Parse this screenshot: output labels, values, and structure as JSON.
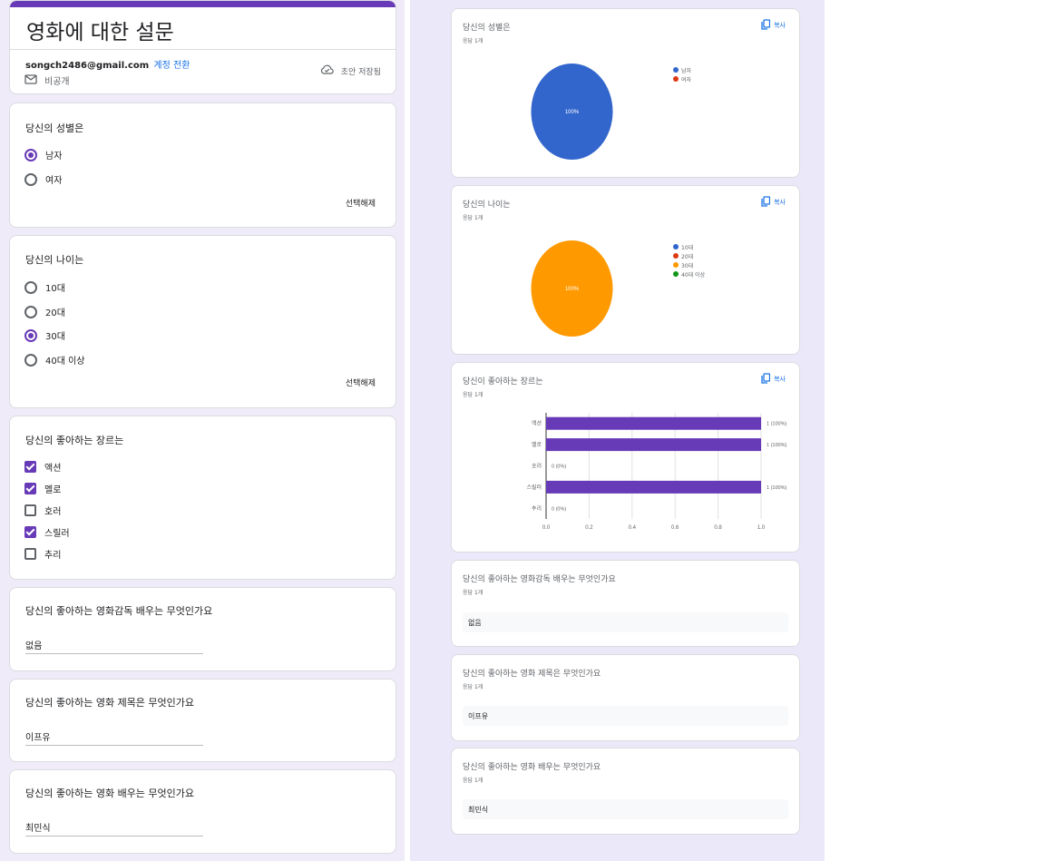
{
  "form": {
    "title": "영화에 대한 설문",
    "account_email": "songch2486@gmail.com",
    "switch_account": "계정 전환",
    "privacy": "비공개",
    "draft_status": "초안 저장됨"
  },
  "questions": [
    {
      "title": "당신의 성별은",
      "type": "radio",
      "options": [
        {
          "label": "남자",
          "selected": true
        },
        {
          "label": "여자",
          "selected": false
        }
      ],
      "clear_label": "선택해제"
    },
    {
      "title": "당신의 나이는",
      "type": "radio",
      "options": [
        {
          "label": "10대",
          "selected": false
        },
        {
          "label": "20대",
          "selected": false
        },
        {
          "label": "30대",
          "selected": true
        },
        {
          "label": "40대 이상",
          "selected": false
        }
      ],
      "clear_label": "선택해제"
    },
    {
      "title": "당신의 좋아하는 장르는",
      "type": "checkbox",
      "options": [
        {
          "label": "액션",
          "checked": true
        },
        {
          "label": "멜로",
          "checked": true
        },
        {
          "label": "호러",
          "checked": false
        },
        {
          "label": "스릴러",
          "checked": true
        },
        {
          "label": "추리",
          "checked": false
        }
      ]
    },
    {
      "title": "당신의 좋아하는 영화감독 배우는 무엇인가요",
      "type": "text",
      "answer": "없음"
    },
    {
      "title": "당신의 좋아하는 영화 제목은 무엇인가요",
      "type": "text",
      "answer": "이프유"
    },
    {
      "title": "당신의 좋아하는 영화 배우는 무엇인가요",
      "type": "text",
      "answer": "최민식"
    }
  ],
  "summary": {
    "copy_label": "복사",
    "response_count": "응답 1개",
    "colors": {
      "blue": "#3366cc",
      "red": "#dc3912",
      "orange": "#ff9900",
      "green": "#109618",
      "purple": "#673ab7"
    },
    "text_answers": [
      {
        "title": "당신의 좋아하는 영화감독 배우는 무엇인가요",
        "count": "응답 1개",
        "answer": "없음"
      },
      {
        "title": "당신의 좋아하는 영화 제목은 무엇인가요",
        "count": "응답 1개",
        "answer": "이프유"
      },
      {
        "title": "당신의 좋아하는 영화 배우는 무엇인가요",
        "count": "응답 1개",
        "answer": "최민식"
      }
    ]
  },
  "chart_data": [
    {
      "type": "pie",
      "title": "당신의 성별은",
      "subtitle": "응답 1개",
      "categories": [
        "남자",
        "여자"
      ],
      "values": [
        1,
        0
      ],
      "slice_label": "100%",
      "colors": [
        "#3366cc",
        "#dc3912"
      ],
      "legend": "right"
    },
    {
      "type": "pie",
      "title": "당신의 나이는",
      "subtitle": "응답 1개",
      "categories": [
        "10대",
        "20대",
        "30대",
        "40대 이상"
      ],
      "values": [
        0,
        0,
        1,
        0
      ],
      "slice_label": "100%",
      "colors": [
        "#3366cc",
        "#dc3912",
        "#ff9900",
        "#109618"
      ],
      "legend": "right"
    },
    {
      "type": "bar",
      "orientation": "horizontal",
      "title": "당신이 좋아하는 장르는",
      "subtitle": "응답 1개",
      "categories": [
        "액션",
        "멜로",
        "호러",
        "스릴러",
        "추리"
      ],
      "values": [
        1,
        1,
        0,
        1,
        0
      ],
      "data_labels": [
        "1 (100%)",
        "1 (100%)",
        "0 (0%)",
        "1 (100%)",
        "0 (0%)"
      ],
      "xlim": [
        0,
        1
      ],
      "xticks": [
        "0.0",
        "0.2",
        "0.4",
        "0.6",
        "0.8",
        "1.0"
      ],
      "color": "#673ab7",
      "grid": true
    }
  ]
}
